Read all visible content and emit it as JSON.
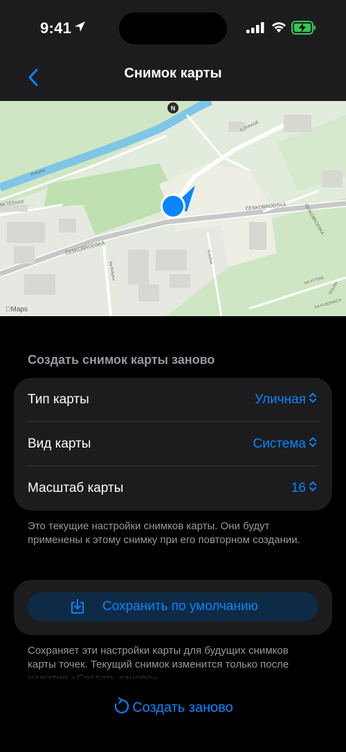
{
  "status_bar": {
    "time": "9:41"
  },
  "nav": {
    "title": "Снимок карты"
  },
  "map": {
    "street_labels": [
      "ČESKOBRODSKÁ",
      "ČESKOBRODSKÁ",
      "ČESKOBRODSKÁ",
      "Rokytka",
      "NA TĚŠINCE",
      "K OHRADĚ",
      "Na Rokytce",
      "NA KLADINÁCH",
      "NA VÝTONI",
      "VLKOVA",
      "DOLINA"
    ],
    "attribution": "Maps",
    "compass": "N"
  },
  "section": {
    "header": "Создать снимок карты заново",
    "rows": [
      {
        "label": "Тип карты",
        "value": "Уличная"
      },
      {
        "label": "Вид карты",
        "value": "Система"
      },
      {
        "label": "Масштаб карты",
        "value": "16"
      }
    ],
    "footnote": "Это текущие настройки снимков карты. Они будут применены к этому снимку при его повторном создании."
  },
  "save": {
    "label": "Сохранить по умолчанию",
    "footnote": "Сохраняет эти настройки карты для будущих снимков карты точек. Текущий снимок изменится только после нажатия «Создать заново»."
  },
  "recreate": {
    "label": "Создать заново"
  },
  "colors": {
    "accent": "#0a84ff",
    "card": "#1c1c1e",
    "secondary_text": "#98989f"
  }
}
